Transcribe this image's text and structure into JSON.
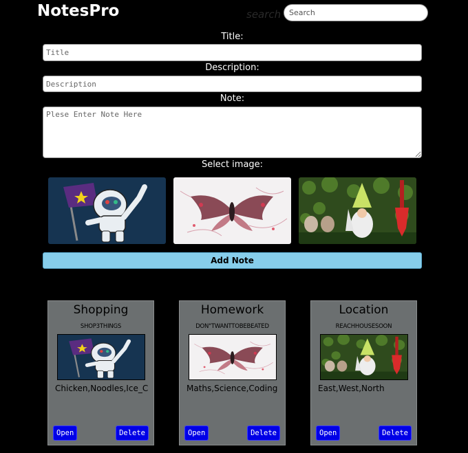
{
  "header": {
    "brand": "NotesPro",
    "search_label": "search",
    "search_placeholder": "Search"
  },
  "form": {
    "title_label": "Title:",
    "title_placeholder": "Title",
    "description_label": "Description:",
    "description_placeholder": "Description",
    "note_label": "Note:",
    "note_placeholder": "Plese Enter Note Here",
    "image_label": "Select image:",
    "images": [
      "astronaut",
      "moth",
      "gnomes"
    ],
    "add_button": "Add Note"
  },
  "notes": [
    {
      "title": "Shopping",
      "description": "SHOP3THINGS",
      "image": "astronaut",
      "note": "Chicken,Noodles,Ice_Cream",
      "open_label": "Open",
      "delete_label": "Delete"
    },
    {
      "title": "Homework",
      "description": "DON\"TWANTTOBEBEATED",
      "image": "moth",
      "note": "Maths,Science,Coding",
      "open_label": "Open",
      "delete_label": "Delete"
    },
    {
      "title": "Location",
      "description": "REACHHOUSESOON",
      "image": "gnomes",
      "note": "East,West,North",
      "open_label": "Open",
      "delete_label": "Delete"
    }
  ],
  "colors": {
    "background": "#000000",
    "add_button": "#87ceeb",
    "card": "#6b6f70",
    "card_button": "#0000e6"
  }
}
